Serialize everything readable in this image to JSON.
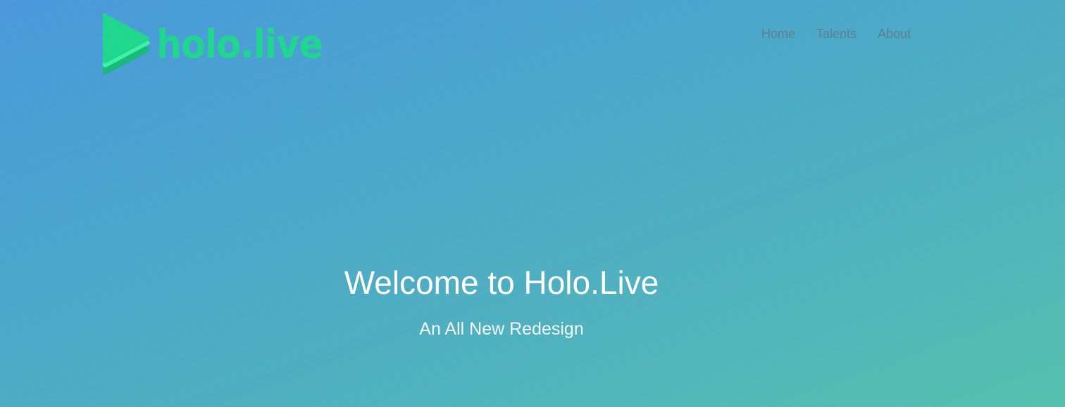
{
  "brand": {
    "logo_text": "holo.live",
    "logo_icon": "play-triangle-icon",
    "accent_color": "#1fd68f"
  },
  "nav": {
    "items": [
      {
        "label": "Home"
      },
      {
        "label": "Talents"
      },
      {
        "label": "About"
      }
    ]
  },
  "hero": {
    "title": "Welcome to Holo.Live",
    "subtitle": "An All New Redesign",
    "gradient_start": "#4a98dc",
    "gradient_end": "#55c0ae"
  }
}
